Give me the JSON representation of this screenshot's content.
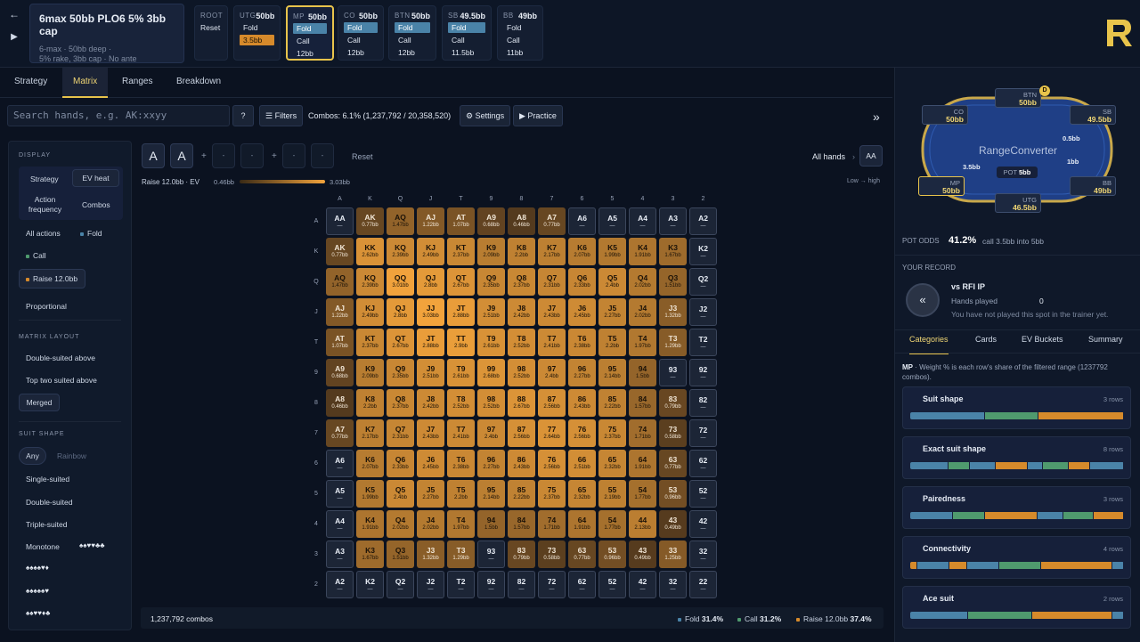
{
  "spot": {
    "title": "6max 50bb PLO6 5% 3bb cap",
    "line1": "6-max · 50bb deep ·",
    "line2": "5% rake, 3bb cap · No ante"
  },
  "root": {
    "label": "ROOT",
    "reset": "Reset"
  },
  "positions": [
    {
      "name": "UTG",
      "stack": "50bb",
      "actions": [
        "Fold",
        "3.5bb"
      ],
      "selected": 1,
      "raise": 1
    },
    {
      "name": "MP",
      "stack": "50bb",
      "actions": [
        "Fold",
        "Call",
        "12bb"
      ],
      "selected": 0
    },
    {
      "name": "CO",
      "stack": "50bb",
      "actions": [
        "Fold",
        "Call",
        "12bb"
      ],
      "selected": 0
    },
    {
      "name": "BTN",
      "stack": "50bb",
      "actions": [
        "Fold",
        "Call",
        "12bb"
      ],
      "selected": 0
    },
    {
      "name": "SB",
      "stack": "49.5bb",
      "actions": [
        "Fold",
        "Call",
        "11.5bb"
      ],
      "selected": 0
    },
    {
      "name": "BB",
      "stack": "49bb",
      "actions": [
        "Fold",
        "Call",
        "11bb"
      ],
      "selected": -1
    }
  ],
  "tabs": [
    "Strategy",
    "Matrix",
    "Ranges",
    "Breakdown"
  ],
  "search": {
    "placeholder": "Search hands, e.g. AK:xxyy",
    "help": "?",
    "filters": "Filters",
    "combos": "Combos: 6.1% (1,237,792 / 20,358,520)",
    "settings": "Settings",
    "practice": "Practice"
  },
  "left": {
    "display": "DISPLAY",
    "strategy": "Strategy",
    "evheat": "EV heat",
    "actionfreq": "Action frequency",
    "combos": "Combos",
    "allactions": "All actions",
    "fold": "Fold",
    "call": "Call",
    "raise": "Raise 12.0bb",
    "proportional": "Proportional",
    "matrixlayout": "MATRIX LAYOUT",
    "ds_above": "Double-suited above",
    "ts_above": "Top two suited above",
    "merged": "Merged",
    "suitshape": "SUIT SHAPE",
    "any": "Any",
    "rainbow": "Rainbow",
    "single": "Single-suited",
    "double": "Double-suited",
    "triple": "Triple-suited",
    "mono": "Monotone",
    "suitsyms": [
      "♠♠♥♥♣♣",
      "♠♠♠♠♥♦",
      "♠♠♠♠♠♥",
      "♠♠♥♥♦♣"
    ]
  },
  "filterbar": {
    "card1": "A",
    "card2": "A",
    "dash": "-",
    "reset": "Reset",
    "allhands": "All hands",
    "selected": "AA"
  },
  "legend": {
    "label": "Raise 12.0bb · EV",
    "min": "0.46bb",
    "max": "3.03bb",
    "range": "Low → high"
  },
  "colors": {
    "fold": "#4a83a8",
    "call": "#4f9a6e",
    "raise": "#d68a2b",
    "accent": "#e8c44b"
  },
  "ranks": [
    "A",
    "K",
    "Q",
    "J",
    "T",
    "9",
    "8",
    "7",
    "6",
    "5",
    "4",
    "3",
    "2"
  ],
  "evmatrix": [
    [
      "—",
      "0.77bb",
      "1.47bb",
      "1.22bb",
      "1.07bb",
      "0.68bb",
      "0.46bb",
      "0.77bb",
      "—",
      "—",
      "—",
      "—",
      "—"
    ],
    [
      "0.77bb",
      "2.62bb",
      "2.39bb",
      "2.49bb",
      "2.37bb",
      "2.09bb",
      "2.2bb",
      "2.17bb",
      "2.07bb",
      "1.99bb",
      "1.91bb",
      "1.67bb",
      "—"
    ],
    [
      "1.47bb",
      "2.39bb",
      "3.01bb",
      "2.8bb",
      "2.67bb",
      "2.35bb",
      "2.37bb",
      "2.31bb",
      "2.33bb",
      "2.4bb",
      "2.02bb",
      "1.51bb",
      "—"
    ],
    [
      "1.22bb",
      "2.49bb",
      "2.8bb",
      "3.03bb",
      "2.88bb",
      "2.51bb",
      "2.42bb",
      "2.43bb",
      "2.45bb",
      "2.27bb",
      "2.02bb",
      "1.32bb",
      "—"
    ],
    [
      "1.07bb",
      "2.37bb",
      "2.67bb",
      "2.88bb",
      "2.9bb",
      "2.61bb",
      "2.52bb",
      "2.41bb",
      "2.38bb",
      "2.2bb",
      "1.97bb",
      "1.29bb",
      "—"
    ],
    [
      "0.68bb",
      "2.09bb",
      "2.35bb",
      "2.51bb",
      "2.61bb",
      "2.68bb",
      "2.52bb",
      "2.4bb",
      "2.27bb",
      "2.14bb",
      "1.5bb",
      "—",
      "—"
    ],
    [
      "0.46bb",
      "2.2bb",
      "2.37bb",
      "2.42bb",
      "2.52bb",
      "2.52bb",
      "2.67bb",
      "2.56bb",
      "2.43bb",
      "2.22bb",
      "1.57bb",
      "0.79bb",
      "—"
    ],
    [
      "0.77bb",
      "2.17bb",
      "2.31bb",
      "2.43bb",
      "2.41bb",
      "2.4bb",
      "2.56bb",
      "2.64bb",
      "2.56bb",
      "2.37bb",
      "1.71bb",
      "0.58bb",
      "—"
    ],
    [
      "—",
      "2.07bb",
      "2.33bb",
      "2.45bb",
      "2.38bb",
      "2.27bb",
      "2.43bb",
      "2.56bb",
      "2.51bb",
      "2.32bb",
      "1.91bb",
      "0.77bb",
      "—"
    ],
    [
      "—",
      "1.99bb",
      "2.4bb",
      "2.27bb",
      "2.2bb",
      "2.14bb",
      "2.22bb",
      "2.37bb",
      "2.32bb",
      "2.19bb",
      "1.77bb",
      "0.96bb",
      "—"
    ],
    [
      "—",
      "1.91bb",
      "2.02bb",
      "2.02bb",
      "1.97bb",
      "1.5bb",
      "1.57bb",
      "1.71bb",
      "1.91bb",
      "1.77bb",
      "2.13bb",
      "0.49bb",
      "—"
    ],
    [
      "—",
      "1.67bb",
      "1.51bb",
      "1.32bb",
      "1.29bb",
      "—",
      "0.79bb",
      "0.58bb",
      "0.77bb",
      "0.96bb",
      "0.49bb",
      "1.25bb",
      "—"
    ],
    [
      "—",
      "—",
      "—",
      "—",
      "—",
      "—",
      "—",
      "—",
      "—",
      "—",
      "—",
      "—",
      "—"
    ]
  ],
  "footer": {
    "combos": "1,237,792 combos",
    "fold": "Fold",
    "fold_pct": "31.4%",
    "call": "Call",
    "call_pct": "31.2%",
    "raise": "Raise 12.0bb",
    "raise_pct": "37.4%"
  },
  "table": {
    "brand": "RangeConverter",
    "pot_label": "POT",
    "pot": "5bb",
    "seats": [
      {
        "pos": "CO",
        "stack": "50bb"
      },
      {
        "pos": "BTN",
        "stack": "50bb"
      },
      {
        "pos": "SB",
        "stack": "49.5bb"
      },
      {
        "pos": "MP",
        "stack": "50bb"
      },
      {
        "pos": "UTG",
        "stack": "46.5bb"
      },
      {
        "pos": "BB",
        "stack": "49bb"
      }
    ],
    "bet_sb": "0.5bb",
    "bet_bb": "1bb",
    "bet_utg": "3.5bb",
    "dealer": "D"
  },
  "potodds": {
    "label": "POT ODDS",
    "pct": "41.2%",
    "desc": "call 3.5bb into 5bb"
  },
  "record": {
    "label": "YOUR RECORD",
    "vs": "vs RFI IP",
    "hands_label": "Hands played",
    "hands": "0",
    "note": "You have not played this spot in the trainer yet."
  },
  "rtabs": [
    "Categories",
    "Cards",
    "EV Buckets",
    "Summary"
  ],
  "catnote_pos": "MP",
  "catnote": " · Weight % is each row's share of the filtered range (1237792 combos).",
  "categories": [
    {
      "title": "Suit shape",
      "rows": "3 rows",
      "segs": [
        [
          "#4a83a8",
          35
        ],
        [
          "#4f9a6e",
          25
        ],
        [
          "#d68a2b",
          40
        ]
      ]
    },
    {
      "title": "Exact suit shape",
      "rows": "8 rows",
      "segs": [
        [
          "#4a83a8",
          18
        ],
        [
          "#4f9a6e",
          10
        ],
        [
          "#4a83a8",
          12
        ],
        [
          "#d68a2b",
          15
        ],
        [
          "#4a83a8",
          7
        ],
        [
          "#4f9a6e",
          12
        ],
        [
          "#d68a2b",
          10
        ],
        [
          "#4a83a8",
          16
        ]
      ]
    },
    {
      "title": "Pairedness",
      "rows": "3 rows",
      "segs": [
        [
          "#4a83a8",
          20
        ],
        [
          "#4f9a6e",
          15
        ],
        [
          "#d68a2b",
          25
        ],
        [
          "#4a83a8",
          12
        ],
        [
          "#4f9a6e",
          14
        ],
        [
          "#d68a2b",
          14
        ]
      ]
    },
    {
      "title": "Connectivity",
      "rows": "4 rows",
      "segs": [
        [
          "#d68a2b",
          3
        ],
        [
          "#4a83a8",
          15
        ],
        [
          "#d68a2b",
          8
        ],
        [
          "#4a83a8",
          15
        ],
        [
          "#4f9a6e",
          20
        ],
        [
          "#d68a2b",
          34
        ],
        [
          "#4a83a8",
          5
        ]
      ]
    },
    {
      "title": "Ace suit",
      "rows": "2 rows",
      "segs": [
        [
          "#4a83a8",
          27
        ],
        [
          "#4f9a6e",
          30
        ],
        [
          "#d68a2b",
          38
        ],
        [
          "#4a83a8",
          5
        ]
      ]
    }
  ]
}
